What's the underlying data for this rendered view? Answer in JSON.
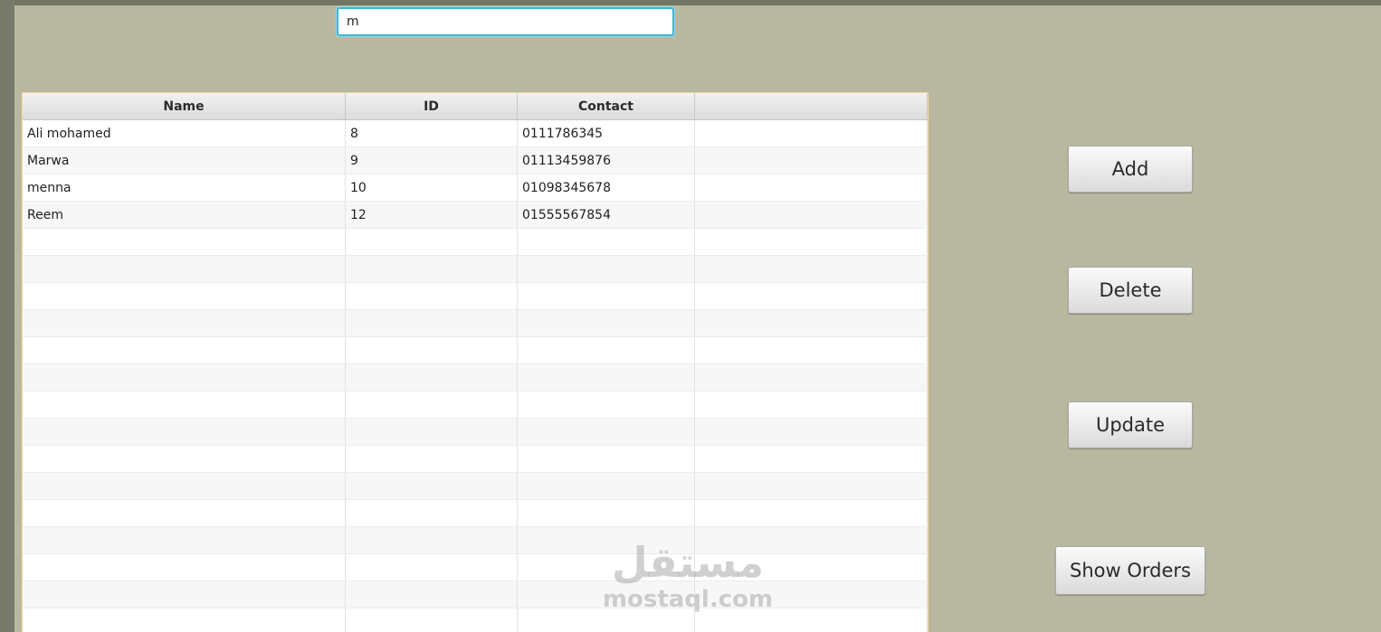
{
  "search": {
    "value": "m"
  },
  "table": {
    "columns": [
      "Name",
      "ID",
      "Contact",
      ""
    ],
    "rows": [
      [
        "Ali mohamed",
        "8",
        "0111786345",
        ""
      ],
      [
        "Marwa",
        "9",
        "01113459876",
        ""
      ],
      [
        "menna",
        "10",
        "01098345678",
        ""
      ],
      [
        "Reem",
        "12",
        "01555567854",
        ""
      ]
    ],
    "empty_row_count": 15
  },
  "buttons": {
    "add": "Add",
    "delete": "Delete",
    "update": "Update",
    "show_orders": "Show Orders"
  },
  "watermark": {
    "arabic": "مستقل",
    "latin": "mostaql.com"
  },
  "colors": {
    "background": "#b8b8a0",
    "search_focus": "#3fb3cf",
    "table_border": "#f3d9a3"
  }
}
